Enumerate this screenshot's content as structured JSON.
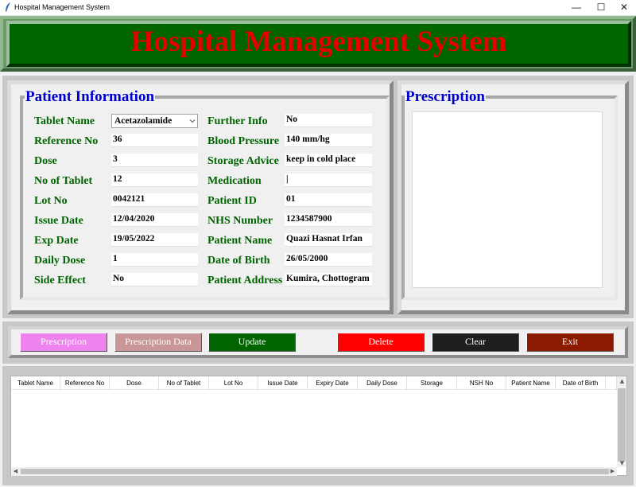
{
  "window": {
    "title": "Hospital Management System",
    "controls": {
      "minimize": "—",
      "maximize": "☐",
      "close": "✕"
    }
  },
  "header": {
    "title": "Hospital Management System"
  },
  "patient_panel": {
    "title": "Patient Information",
    "left_fields": [
      {
        "label": "Tablet Name",
        "value": "Acetazolamide",
        "type": "combobox"
      },
      {
        "label": "Reference No",
        "value": "36"
      },
      {
        "label": "Dose",
        "value": "3"
      },
      {
        "label": "No of Tablet",
        "value": "12"
      },
      {
        "label": "Lot No",
        "value": "0042121"
      },
      {
        "label": "Issue Date",
        "value": "12/04/2020"
      },
      {
        "label": "Exp Date",
        "value": "19/05/2022"
      },
      {
        "label": "Daily Dose",
        "value": "1"
      },
      {
        "label": "Side Effect",
        "value": "No"
      }
    ],
    "right_fields": [
      {
        "label": "Further Info",
        "value": "No"
      },
      {
        "label": "Blood Pressure",
        "value": "140 mm/hg"
      },
      {
        "label": "Storage Advice",
        "value": "keep in cold place"
      },
      {
        "label": "Medication",
        "value": "|"
      },
      {
        "label": "Patient ID",
        "value": "01"
      },
      {
        "label": "NHS Number",
        "value": "1234587900"
      },
      {
        "label": "Patient Name",
        "value": "Quazi Hasnat Irfan"
      },
      {
        "label": "Date of Birth",
        "value": "26/05/2000"
      },
      {
        "label": "Patient Address",
        "value": "Kumira, Chottogram"
      }
    ]
  },
  "prescription_panel": {
    "title": "Prescription",
    "text": ""
  },
  "buttons": [
    {
      "label": "Prescription",
      "bg": "#ee82ee",
      "fg": "#ffffff"
    },
    {
      "label": "Prescription Data",
      "bg": "#c89696",
      "fg": "#ffffff"
    },
    {
      "label": "Update",
      "bg": "#006400",
      "fg": "#ffffff"
    },
    {
      "label": "Delete",
      "bg": "#ff0000",
      "fg": "#ffffff"
    },
    {
      "label": "Clear",
      "bg": "#1e1e1e",
      "fg": "#ffffff"
    },
    {
      "label": "Exit",
      "bg": "#8b1a00",
      "fg": "#ffffff"
    }
  ],
  "table": {
    "columns": [
      "Tablet Name",
      "Reference No",
      "Dose",
      "No of Tablet",
      "Lot No",
      "Issue Date",
      "Expiry Date",
      "Daily Dose",
      "Storage",
      "NSH No",
      "Patient Name",
      "Date of Birth"
    ],
    "rows": []
  },
  "colors": {
    "title_red": "#e60000",
    "header_green": "#006400",
    "legend_blue": "#0000cc",
    "label_green": "#006400"
  }
}
